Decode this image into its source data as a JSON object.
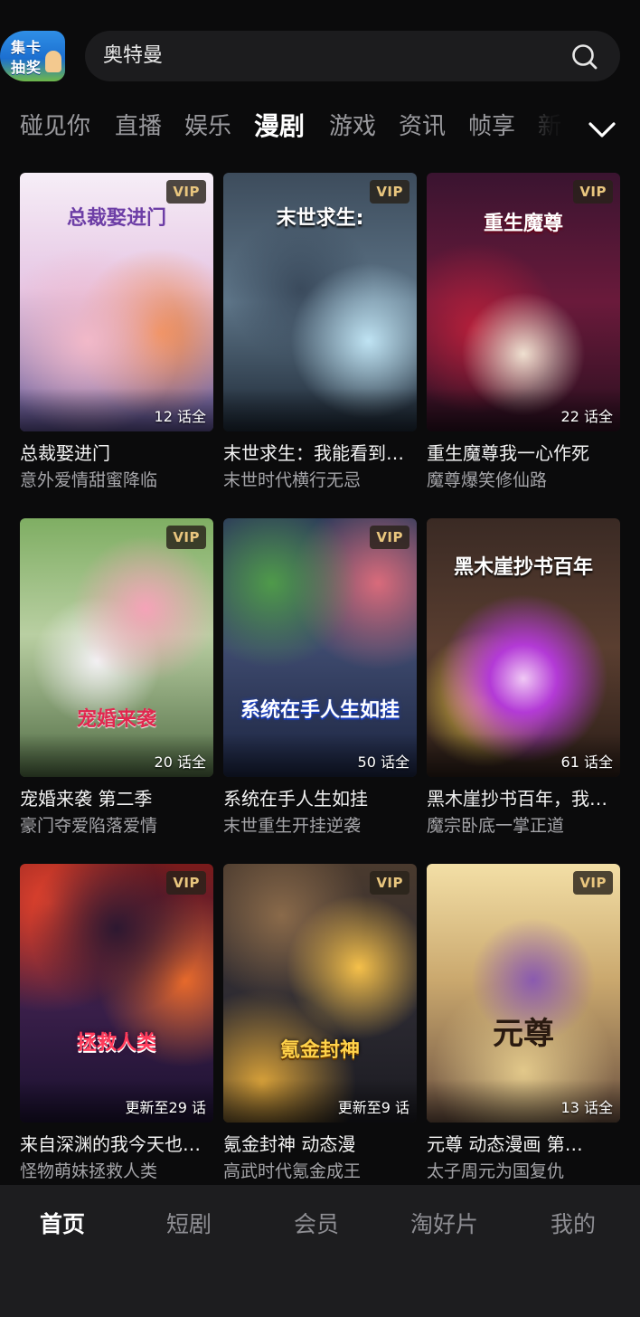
{
  "header": {
    "promo_line1": "集卡",
    "promo_line2": "抽奖",
    "search_query": "奥特曼"
  },
  "tabs": [
    {
      "label": "碰见你"
    },
    {
      "label": "直播"
    },
    {
      "label": "娱乐"
    },
    {
      "label": "漫剧"
    },
    {
      "label": "游戏"
    },
    {
      "label": "资讯"
    },
    {
      "label": "帧享"
    },
    {
      "label": "新"
    }
  ],
  "active_tab": "漫剧",
  "cards": [
    {
      "badge": "VIP",
      "episodes": "12 话全",
      "title": "总裁娶进门",
      "subtitle": "意外爱情甜蜜降临",
      "cover_text": "总裁娶进门"
    },
    {
      "badge": "VIP",
      "episodes": "",
      "title": "末世求生：我能看到…",
      "subtitle": "末世时代横行无忌",
      "cover_text": "末世求生:"
    },
    {
      "badge": "VIP",
      "episodes": "22 话全",
      "title": "重生魔尊我一心作死",
      "subtitle": "魔尊爆笑修仙路",
      "cover_text": "重生魔尊"
    },
    {
      "badge": "VIP",
      "episodes": "20 话全",
      "title": "宠婚来袭 第二季",
      "subtitle": "豪门夺爱陷落爱情",
      "cover_text": "宠婚来袭"
    },
    {
      "badge": "VIP",
      "episodes": "50 话全",
      "title": "系统在手人生如挂",
      "subtitle": "末世重生开挂逆袭",
      "cover_text": "系统在手人生如挂"
    },
    {
      "badge": "",
      "episodes": "61 话全",
      "title": "黑木崖抄书百年，我…",
      "subtitle": "魔宗卧底一掌正道",
      "cover_text": "黑木崖抄书百年"
    },
    {
      "badge": "VIP",
      "episodes": "更新至29 话",
      "title": "来自深渊的我今天也…",
      "subtitle": "怪物萌妹拯救人类",
      "cover_text": "拯救人类"
    },
    {
      "badge": "VIP",
      "episodes": "更新至9 话",
      "title": "氪金封神 动态漫",
      "subtitle": "高武时代氪金成王",
      "cover_text": "氪金封神"
    },
    {
      "badge": "VIP",
      "episodes": "13 话全",
      "title": "元尊 动态漫画 第…",
      "subtitle": "太子周元为国复仇",
      "cover_text": "元尊"
    }
  ],
  "bottom_nav": [
    {
      "label": "首页"
    },
    {
      "label": "短剧"
    },
    {
      "label": "会员"
    },
    {
      "label": "淘好片"
    },
    {
      "label": "我的"
    }
  ],
  "colors": {
    "background": "#0b0b0c",
    "vip_text": "#e9c67e",
    "tab_inactive": "#9a9a9e",
    "nav_bar": "#1d1d1f"
  },
  "icons": [
    "search-icon",
    "chevron-down-icon"
  ]
}
